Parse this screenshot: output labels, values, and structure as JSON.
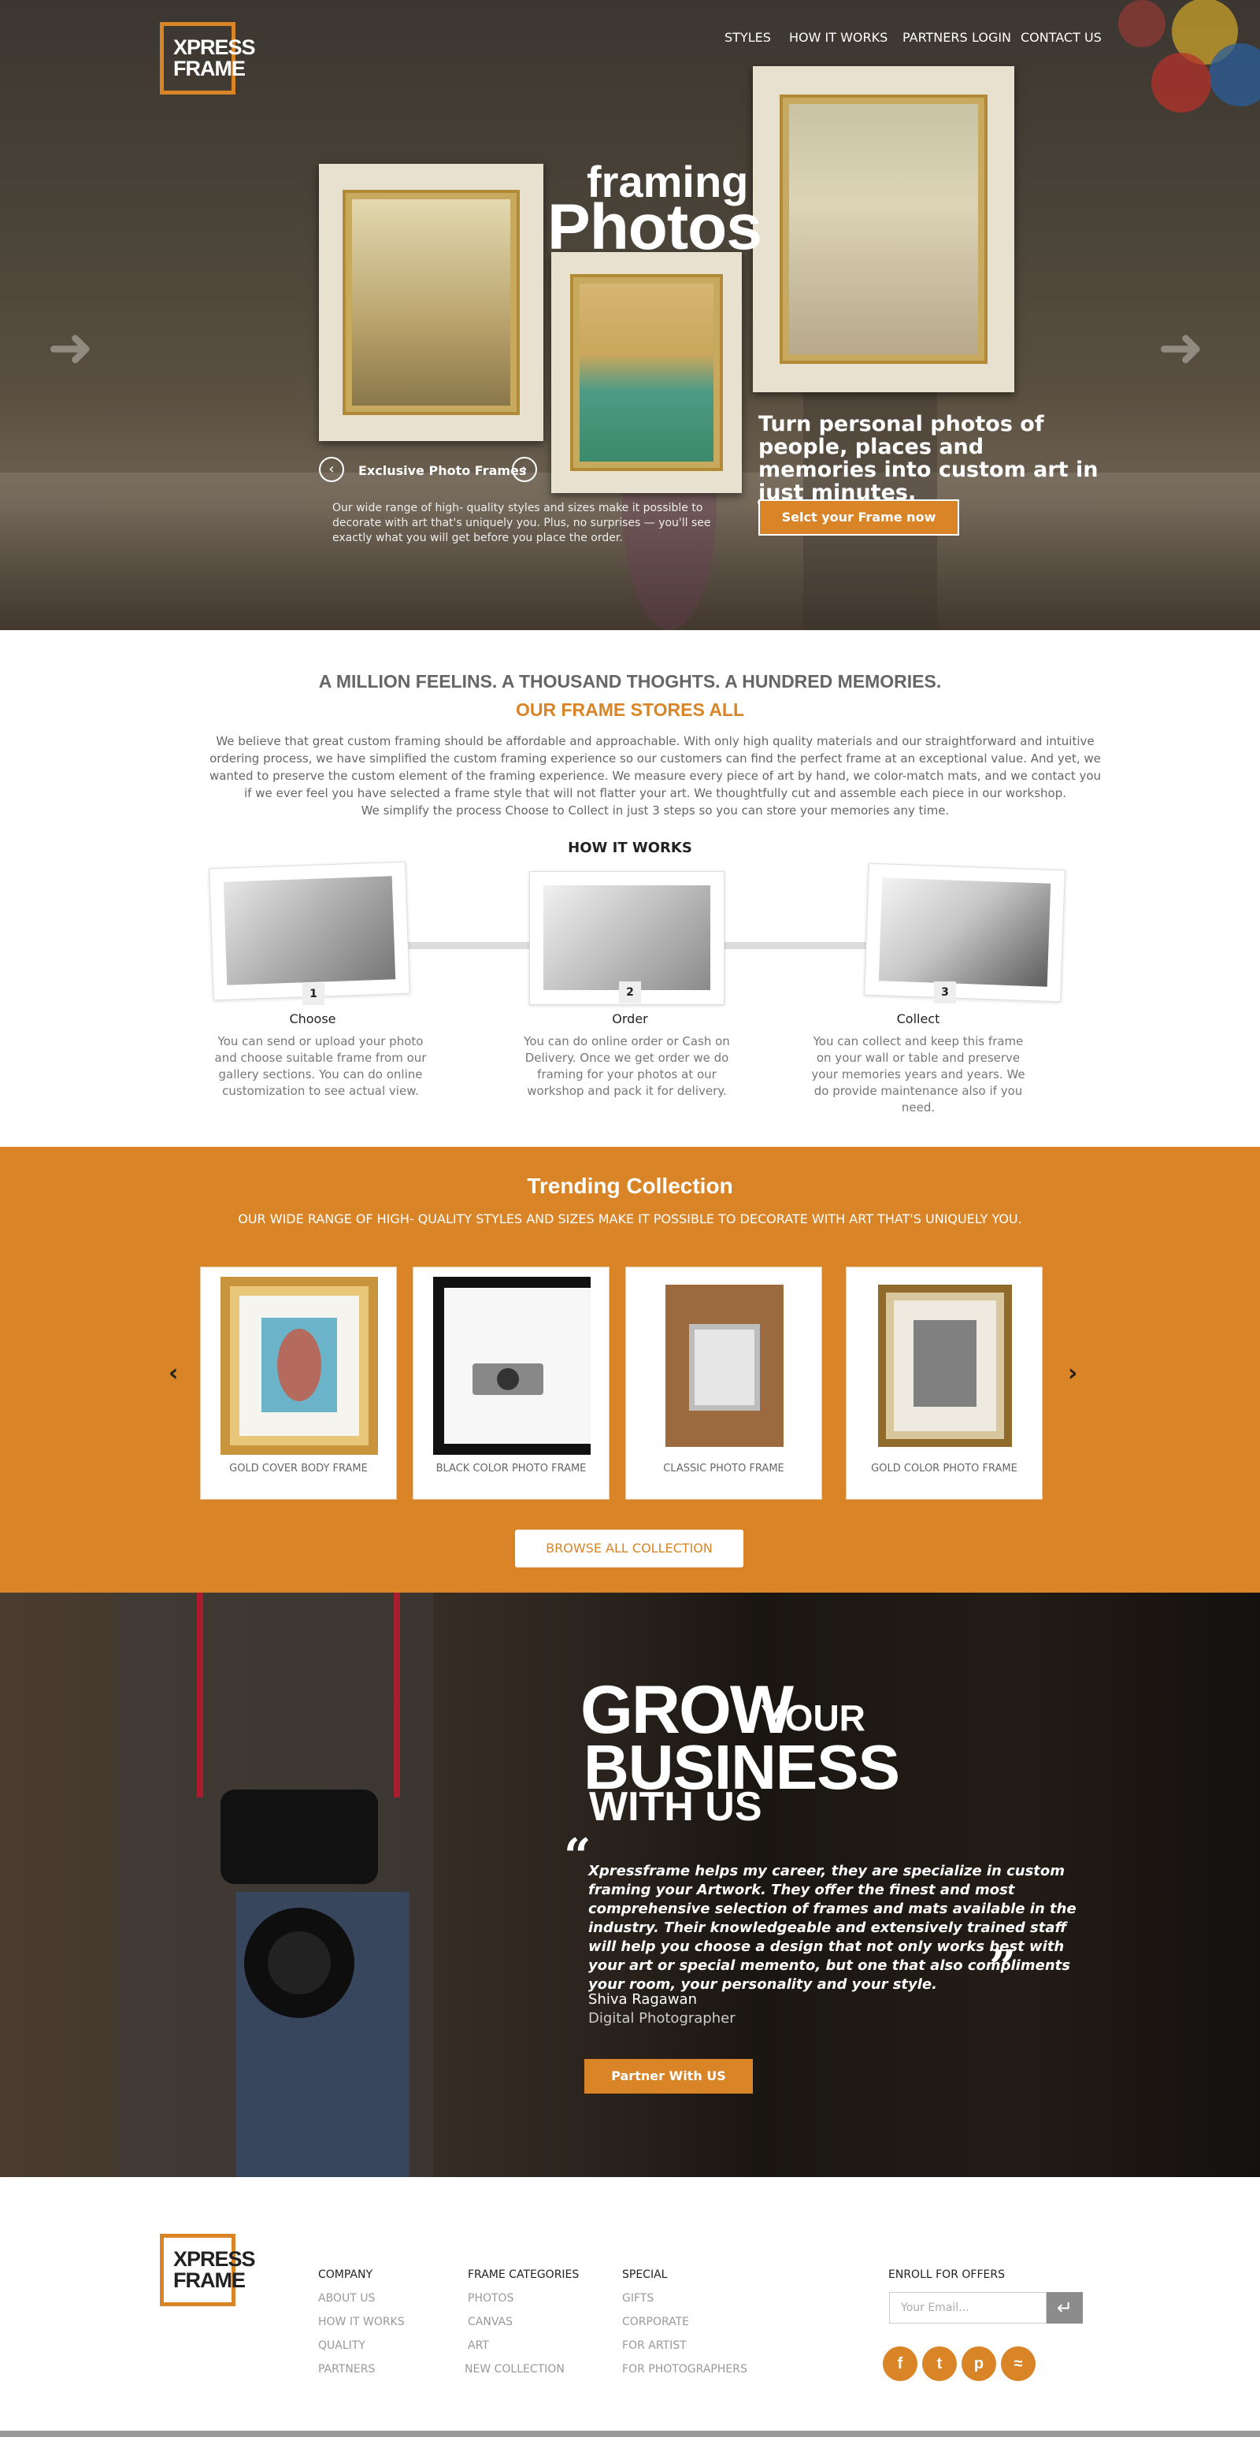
{
  "brand": {
    "line1": "XPRESS",
    "line2": "FRAME",
    "accent": "#d98426"
  },
  "nav": [
    "STYLES",
    "HOW IT WORKS",
    "PARTNERS",
    "LOGIN",
    "CONTACT US"
  ],
  "hero": {
    "title_small": "framing",
    "title_big": "Photos",
    "exclusive_label": "Exclusive Photo Frames",
    "description": "Our wide range of high- quality styles and sizes make it possible to decorate with art that's uniquely you. Plus, no surprises — you'll see exactly what you will get before you place the order.",
    "headline": "Turn personal photos of people, places and memories into custom art in just minutes.",
    "cta": "Selct your Frame now"
  },
  "intro": {
    "heading": "A MILLION FEELINS. A THOUSAND THOGHTS. A HUNDRED MEMORIES.",
    "subheading": "OUR FRAME STORES ALL",
    "paragraph": "We believe that great custom framing should be affordable and approachable. With only high quality materials and our straightforward and intuitive ordering process, we have simplified the custom framing experience so our customers can find the perfect frame at an exceptional value. And yet, we wanted to preserve the custom element of the framing experience. We measure every piece of art by hand, we color-match mats, and we contact you if we ever feel you have selected a frame style that will not flatter your art. We thoughtfully cut and assemble each piece in our workshop.",
    "paragraph2": "We simplify the process Choose to Collect in just 3 steps so you can store your memories any time."
  },
  "how_it_works": {
    "title": "HOW IT WORKS",
    "steps": [
      {
        "num": "1",
        "name": "Choose",
        "desc": "You can send or upload your photo and choose suitable frame from our gallery sections. You can do online customization to see actual view."
      },
      {
        "num": "2",
        "name": "Order",
        "desc": "You can do online order or Cash on Delivery. Once we get order we do framing for your photos at our workshop and pack it for delivery."
      },
      {
        "num": "3",
        "name": "Collect",
        "desc": "You can collect and keep this frame on your wall or table and preserve your memories years and years. We do provide maintenance also if you need."
      }
    ]
  },
  "trending": {
    "title": "Trending Collection",
    "subtitle": "OUR WIDE RANGE OF HIGH- QUALITY STYLES AND SIZES MAKE IT POSSIBLE TO DECORATE WITH ART THAT'S UNIQUELY YOU.",
    "items": [
      "GOLD COVER BODY FRAME",
      "BLACK COLOR PHOTO FRAME",
      "CLASSIC PHOTO FRAME",
      "GOLD COLOR PHOTO FRAME"
    ],
    "browse": "BROWSE ALL COLLECTION"
  },
  "testimonial": {
    "grow1": "GROW",
    "grow2": "YOUR",
    "grow3": "BUSINESS",
    "grow4": "WITH US",
    "quote": "Xpressframe helps my career,  they are specialize in custom framing your Artwork. They offer the finest and most comprehensive selection of frames and mats available in the industry. Their knowledgeable and extensively trained staff will help you choose a design that not only works best with your art or special memento, but one that also compliments your room, your personality and your style.",
    "name": "Shiva Ragawan",
    "role": "Digital Photographer",
    "cta": "Partner With US"
  },
  "footer": {
    "company": {
      "title": "COMPANY",
      "links": [
        "ABOUT US",
        "HOW IT WORKS",
        "QUALITY",
        "PARTNERS"
      ]
    },
    "categories": {
      "title": "FRAME CATEGORIES",
      "links": [
        "PHOTOS",
        "CANVAS",
        "ART",
        "NEW COLLECTION"
      ]
    },
    "special": {
      "title": "SPECIAL",
      "links": [
        "GIFTS",
        "CORPORATE",
        "FOR ARTIST",
        "FOR PHOTOGRAPHERS"
      ]
    },
    "enroll": {
      "title": "ENROLL FOR OFFERS",
      "placeholder": "Your Email..."
    },
    "social": [
      "facebook-icon",
      "twitter-icon",
      "pinterest-icon",
      "rss-icon"
    ]
  }
}
